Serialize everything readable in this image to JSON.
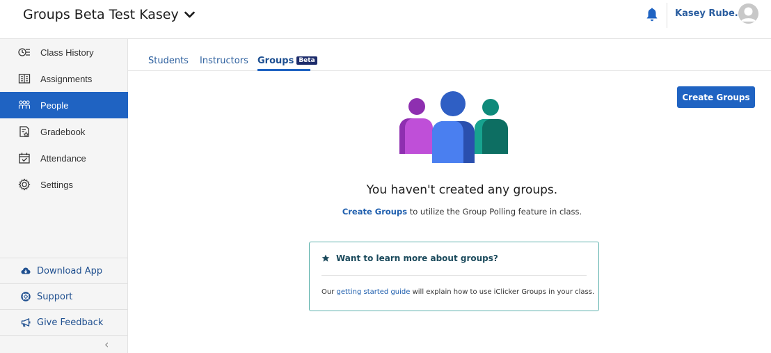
{
  "header": {
    "course_title": "Groups Beta Test Kasey",
    "user_name": "Kasey Rube..."
  },
  "sidebar": {
    "items": [
      {
        "label": "Class History",
        "icon": "class-history-icon"
      },
      {
        "label": "Assignments",
        "icon": "assignments-icon"
      },
      {
        "label": "People",
        "icon": "people-icon",
        "active": true
      },
      {
        "label": "Gradebook",
        "icon": "gradebook-icon"
      },
      {
        "label": "Attendance",
        "icon": "attendance-icon"
      },
      {
        "label": "Settings",
        "icon": "settings-icon"
      }
    ],
    "bottom": [
      {
        "label": "Download App",
        "icon": "cloud-download-icon"
      },
      {
        "label": "Support",
        "icon": "lifebuoy-icon"
      },
      {
        "label": "Give Feedback",
        "icon": "megaphone-icon"
      }
    ],
    "collapse": "‹"
  },
  "tabs": {
    "students": "Students",
    "instructors": "Instructors",
    "groups": "Groups",
    "groups_badge": "Beta"
  },
  "main": {
    "create_button": "Create Groups",
    "empty_title": "You haven't created any groups.",
    "empty_link": "Create Groups",
    "empty_rest": " to utilize the Group Polling feature in class."
  },
  "info": {
    "title": "Want to learn more about groups?",
    "text_before": "Our ",
    "link": "getting started guide",
    "text_after": " will explain how to use iClicker Groups in your class."
  },
  "colors": {
    "accent": "#1f63c2",
    "person_left": "#8e2fb0",
    "person_middle": "#2f5fc4",
    "person_right": "#0f8a7a",
    "info_border": "#5fb2ad"
  }
}
